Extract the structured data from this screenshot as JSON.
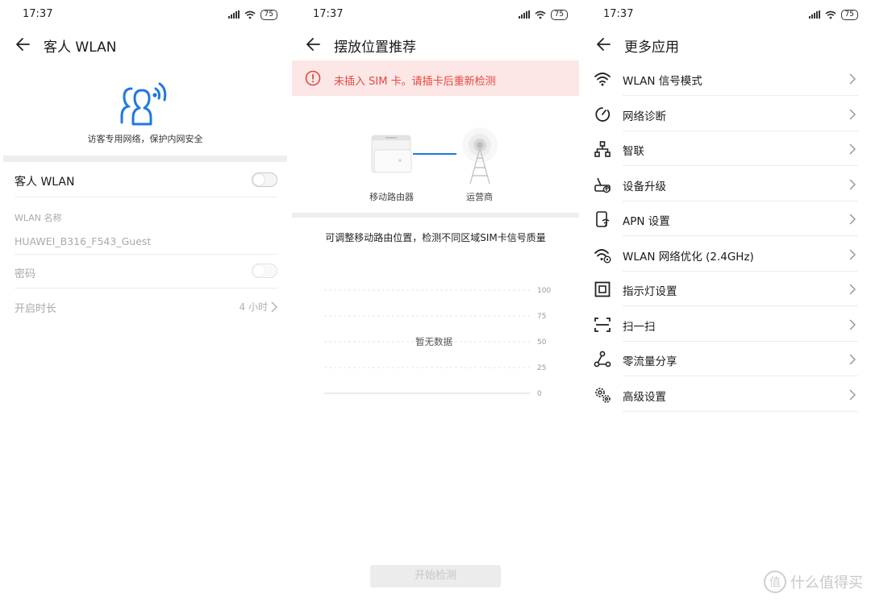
{
  "screens": [
    {
      "time": "17:37",
      "battery": "75",
      "title": "客人 WLAN",
      "hero_caption": "访客专用网络，保护内网安全",
      "guest_toggle_label": "客人 WLAN",
      "guest_toggle_on": false,
      "wlan_name_label": "WLAN 名称",
      "wlan_name_value": "HUAWEI_B316_F543_Guest",
      "password_label": "密码",
      "duration_label": "开启时长",
      "duration_value": "4 小时"
    },
    {
      "time": "17:37",
      "battery": "75",
      "title": "摆放位置推荐",
      "alert_text": "未插入 SIM 卡。请插卡后重新检测",
      "router_label": "移动路由器",
      "carrier_label": "运营商",
      "hint": "可调整移动路由位置，检测不同区域SIM卡信号质量",
      "empty_text": "暂无数据",
      "start_button": "开始检测",
      "chart_data": {
        "type": "line",
        "series": [],
        "y_ticks": [
          "100",
          "75",
          "50",
          "25",
          "0"
        ],
        "ylim": [
          0,
          100
        ],
        "grid": true
      }
    },
    {
      "time": "17:37",
      "battery": "75",
      "title": "更多应用",
      "items": [
        {
          "label": "WLAN 信号模式",
          "icon": "wifi-icon"
        },
        {
          "label": "网络诊断",
          "icon": "diagnosis-icon"
        },
        {
          "label": "智联",
          "icon": "network-tree-icon"
        },
        {
          "label": "设备升级",
          "icon": "router-upgrade-icon"
        },
        {
          "label": "APN 设置",
          "icon": "apn-phone-icon"
        },
        {
          "label": "WLAN 网络优化 (2.4GHz)",
          "icon": "wifi-optimize-icon"
        },
        {
          "label": "指示灯设置",
          "icon": "indicator-light-icon"
        },
        {
          "label": "扫一扫",
          "icon": "scan-icon"
        },
        {
          "label": "零流量分享",
          "icon": "share-icon"
        },
        {
          "label": "高级设置",
          "icon": "gears-icon"
        }
      ]
    }
  ],
  "watermark": "什么值得买",
  "watermark_logo": "值"
}
